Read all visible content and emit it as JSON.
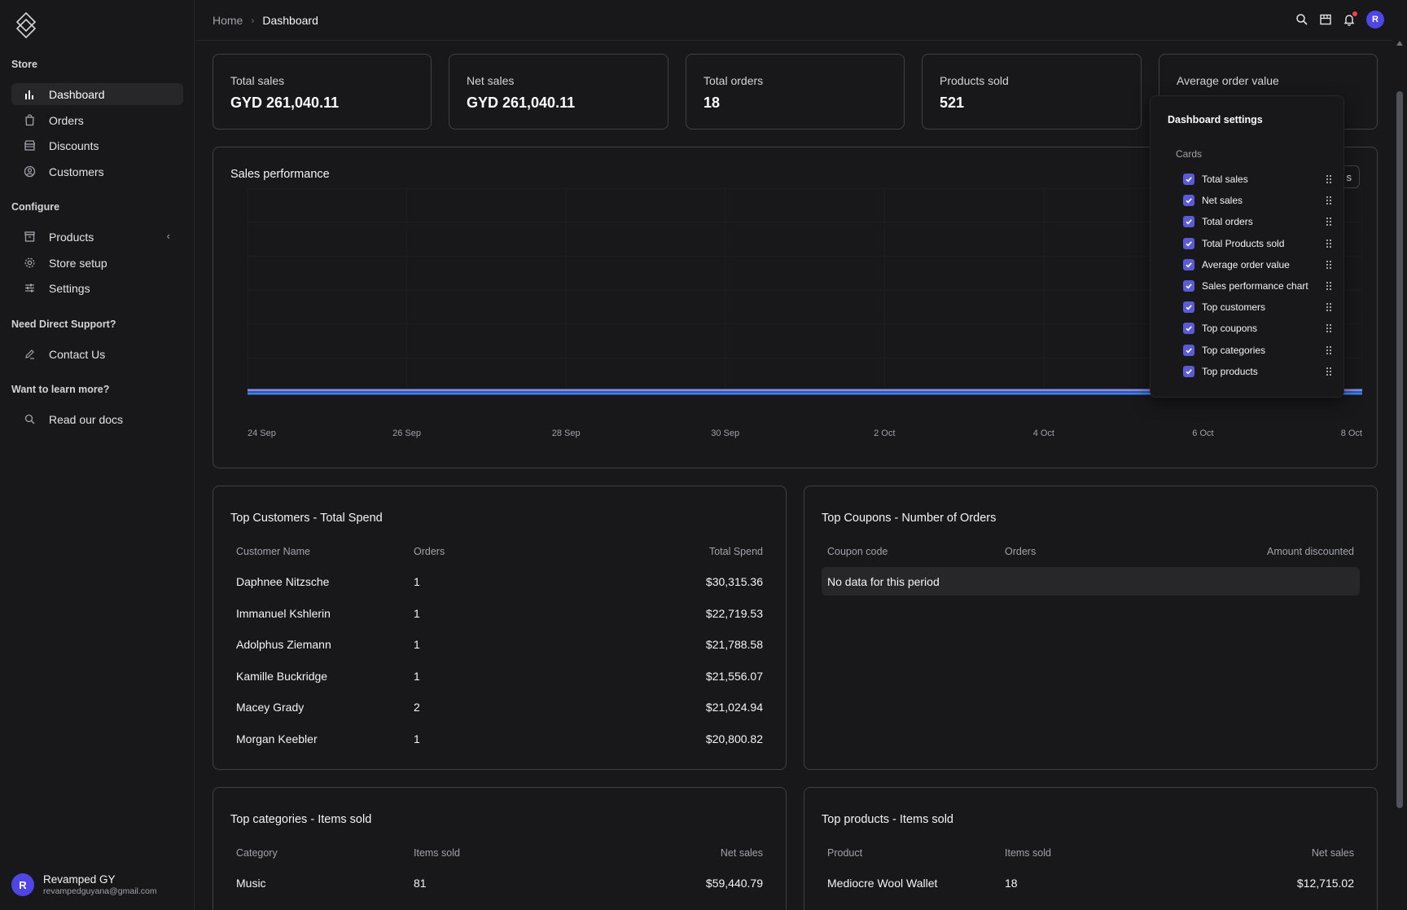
{
  "sidebar": {
    "sections": {
      "store": "Store",
      "configure": "Configure",
      "support": "Need Direct Support?",
      "learn": "Want to learn more?"
    },
    "items": {
      "dashboard": "Dashboard",
      "orders": "Orders",
      "discounts": "Discounts",
      "customers": "Customers",
      "products": "Products",
      "store_setup": "Store setup",
      "settings": "Settings",
      "contact": "Contact Us",
      "docs": "Read our docs"
    },
    "user": {
      "initial": "R",
      "name": "Revamped GY",
      "email": "revampedguyana@gmail.com"
    }
  },
  "header": {
    "breadcrumb": [
      "Home",
      "Dashboard"
    ],
    "avatar_initial": "R",
    "accent_color": "#4f46e5"
  },
  "stats": [
    {
      "label": "Total sales",
      "value": "GYD 261,040.11"
    },
    {
      "label": "Net sales",
      "value": "GYD 261,040.11"
    },
    {
      "label": "Total orders",
      "value": "18"
    },
    {
      "label": "Products sold",
      "value": "521"
    },
    {
      "label": "Average order value",
      "value": ""
    }
  ],
  "sales_chart": {
    "title": "Sales performance",
    "peek_button_label": "s",
    "chart_data": {
      "type": "line",
      "x": [
        "24 Sep",
        "26 Sep",
        "28 Sep",
        "30 Sep",
        "2 Oct",
        "4 Oct",
        "6 Oct",
        "8 Oct"
      ],
      "series": [
        {
          "color": "#818cf8",
          "values": [
            0,
            0,
            0,
            0,
            0,
            0,
            0,
            0
          ]
        },
        {
          "color": "#3b82f6",
          "values": [
            0,
            0,
            0,
            0,
            0,
            0,
            0,
            0
          ]
        }
      ],
      "grid": true
    }
  },
  "top_customers": {
    "title": "Top Customers - Total Spend",
    "columns": [
      "Customer Name",
      "Orders",
      "Total Spend"
    ],
    "rows": [
      [
        "Daphnee Nitzsche",
        "1",
        "$30,315.36"
      ],
      [
        "Immanuel Kshlerin",
        "1",
        "$22,719.53"
      ],
      [
        "Adolphus Ziemann",
        "1",
        "$21,788.58"
      ],
      [
        "Kamille Buckridge",
        "1",
        "$21,556.07"
      ],
      [
        "Macey Grady",
        "2",
        "$21,024.94"
      ],
      [
        "Morgan Keebler",
        "1",
        "$20,800.82"
      ]
    ]
  },
  "top_coupons": {
    "title": "Top Coupons - Number of Orders",
    "columns": [
      "Coupon code",
      "Orders",
      "Amount discounted"
    ],
    "empty": "No data for this period"
  },
  "top_categories": {
    "title": "Top categories - Items sold",
    "columns": [
      "Category",
      "Items sold",
      "Net sales"
    ],
    "rows": [
      [
        "Music",
        "81",
        "$59,440.79"
      ]
    ]
  },
  "top_products": {
    "title": "Top products - Items sold",
    "columns": [
      "Product",
      "Items sold",
      "Net sales"
    ],
    "rows": [
      [
        "Mediocre Wool Wallet",
        "18",
        "$12,715.02"
      ]
    ]
  },
  "settings_popover": {
    "title": "Dashboard settings",
    "subtitle": "Cards",
    "items": [
      "Total sales",
      "Net sales",
      "Total orders",
      "Total Products sold",
      "Average order value",
      "Sales performance chart",
      "Top customers",
      "Top coupons",
      "Top categories",
      "Top products"
    ]
  }
}
